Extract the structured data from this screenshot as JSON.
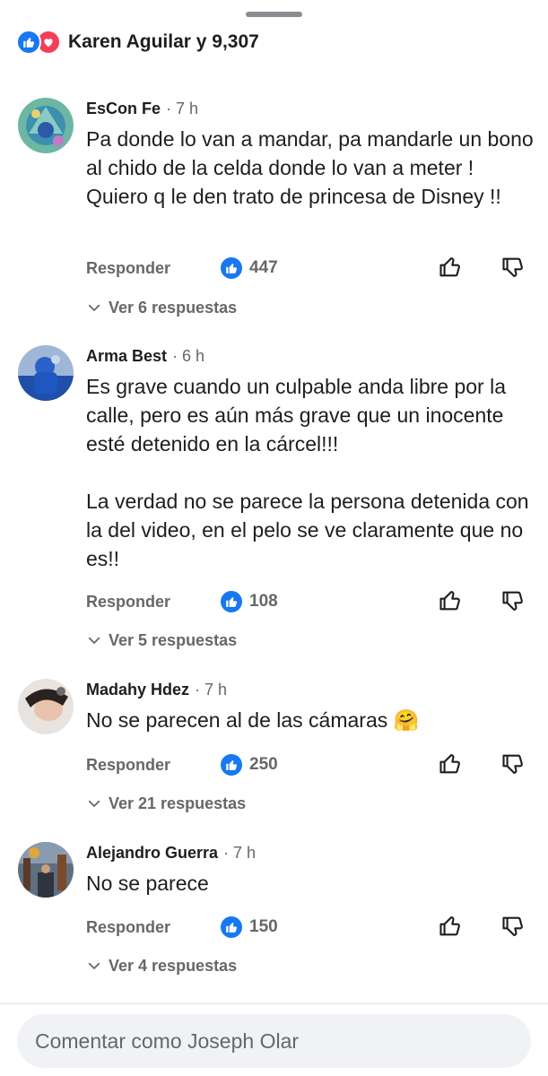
{
  "reactions": {
    "summary": "Karen Aguilar y 9,307",
    "icons": [
      "like-icon",
      "love-icon"
    ]
  },
  "comments": [
    {
      "author": "EsCon Fe",
      "separator": "·",
      "time": "7 h",
      "paragraphs": [
        "Pa donde lo van a mandar, pa mandarle un bono al chido de la celda donde lo van a meter ! Quiero q le den trato de princesa de Disney !!"
      ],
      "reply_label": "Responder",
      "likes": "447",
      "view_replies": "Ver 6 respuestas"
    },
    {
      "author": "Arma Best",
      "separator": "·",
      "time": "6 h",
      "paragraphs": [
        "Es grave cuando un culpable anda libre por la calle, pero es aún más grave que un inocente esté detenido en la cárcel!!!",
        "La verdad no se parece la persona detenida con la del video, en el pelo se ve claramente que no es!!"
      ],
      "reply_label": "Responder",
      "likes": "108",
      "view_replies": "Ver 5 respuestas"
    },
    {
      "author": "Madahy Hdez",
      "separator": "·",
      "time": "7 h",
      "paragraphs": [
        "No se parecen al de las cámaras 🤗"
      ],
      "reply_label": "Responder",
      "likes": "250",
      "view_replies": "Ver 21 respuestas"
    },
    {
      "author": "Alejandro Guerra",
      "separator": "·",
      "time": "7 h",
      "paragraphs": [
        "No se parece"
      ],
      "reply_label": "Responder",
      "likes": "150",
      "view_replies": "Ver 4 respuestas"
    }
  ],
  "composer": {
    "placeholder": "Comentar como Joseph Olar"
  },
  "colors": {
    "like_blue": "#1877f2",
    "love_red": "#f33e58",
    "secondary_text": "#65676b",
    "primary_text": "#1c1e21",
    "composer_bg": "#f0f2f5"
  }
}
